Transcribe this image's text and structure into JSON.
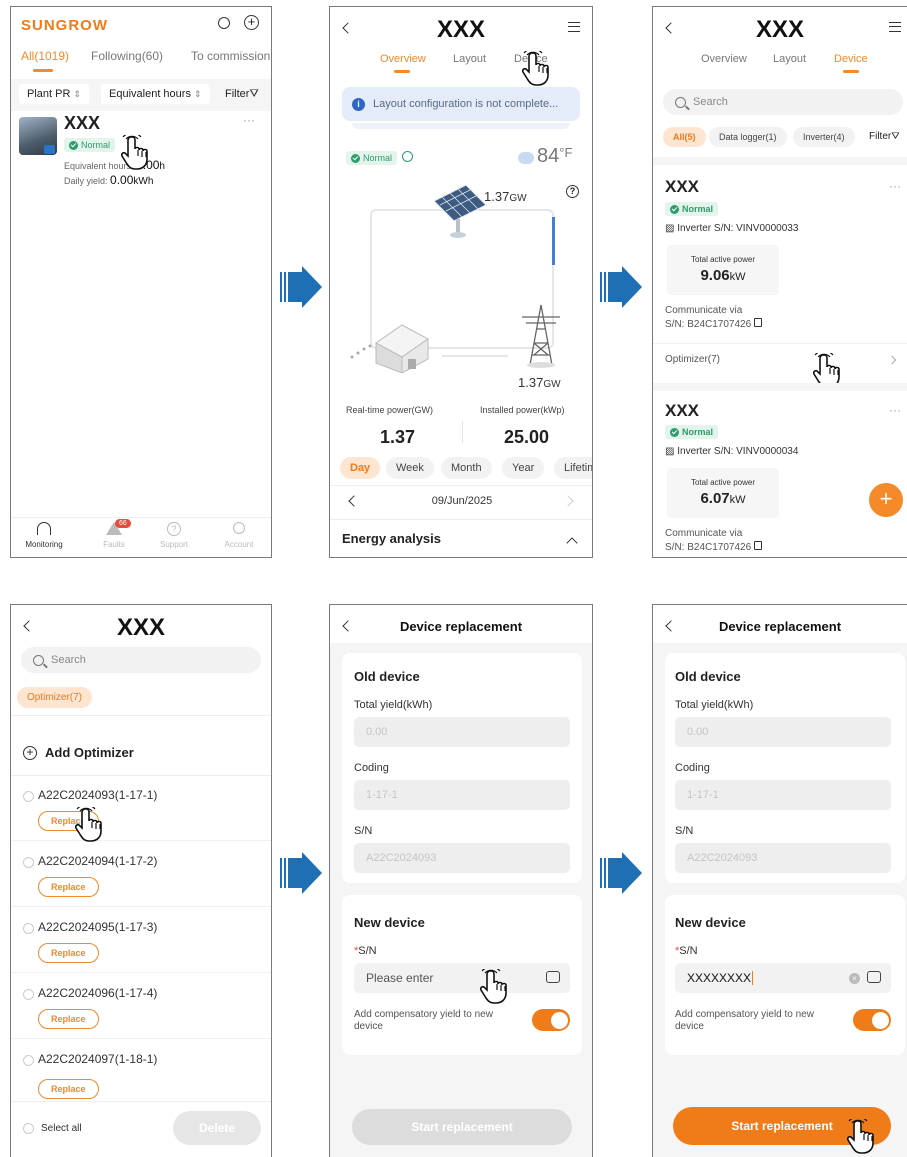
{
  "colors": {
    "accent": "#f08a2c",
    "normal": "#2f9c6b",
    "arrow": "#1f6fb5"
  },
  "p1": {
    "brand": "SUNGROW",
    "tabs": [
      "All(1019)",
      "Following(60)",
      "To commission"
    ],
    "filters": [
      "Plant PR",
      "Equivalent hours",
      "Filter"
    ],
    "plant": {
      "name": "XXX",
      "status": "Normal",
      "eq_label": "Equivalent hours:",
      "eq_value": "0.00",
      "eq_unit": "h",
      "dy_label": "Daily yield:",
      "dy_value": "0.00",
      "dy_unit": "kWh"
    },
    "bottom": [
      "Monitoring",
      "Faults",
      "Support",
      "Account"
    ],
    "faults_badge": "66"
  },
  "p2": {
    "title": "XXX",
    "tabs": [
      "Overview",
      "Layout",
      "Device"
    ],
    "banner": "Layout configuration is not complete...",
    "status": "Normal",
    "temp": "84",
    "temp_unit": "°F",
    "pv_value": "1.37",
    "pv_unit": "GW",
    "grid_value": "1.37",
    "grid_unit": "GW",
    "rt_label": "Real-time power(GW)",
    "rt_value": "1.37",
    "ip_label": "Installed power(kWp)",
    "ip_value": "25.00",
    "periods": [
      "Day",
      "Week",
      "Month",
      "Year",
      "Lifetime"
    ],
    "date": "09/Jun/2025",
    "energy": "Energy analysis"
  },
  "p3": {
    "title": "XXX",
    "tabs": [
      "Overview",
      "Layout",
      "Device"
    ],
    "search": "Search",
    "chips": [
      "All(5)",
      "Data logger(1)",
      "Inverter(4)"
    ],
    "filter": "Filter",
    "devices": [
      {
        "name": "XXX",
        "status": "Normal",
        "sn": "Inverter S/N: VINV0000033",
        "power_label": "Total active power",
        "power_value": "9.06",
        "power_unit": "kW",
        "comm1": "Communicate via",
        "comm2": "S/N: B24C1707426",
        "optimizer": "Optimizer(7)"
      },
      {
        "name": "XXX",
        "status": "Normal",
        "sn": "Inverter S/N: VINV0000034",
        "power_label": "Total active power",
        "power_value": "6.07",
        "power_unit": "kW",
        "comm1": "Communicate via",
        "comm2": "S/N: B24C1707426"
      }
    ]
  },
  "p4": {
    "title": "XXX",
    "search": "Search",
    "chip": "Optimizer(7)",
    "add": "Add Optimizer",
    "items": [
      "A22C2024093(1-17-1)",
      "A22C2024094(1-17-2)",
      "A22C2024095(1-17-3)",
      "A22C2024096(1-17-4)",
      "A22C2024097(1-18-1)"
    ],
    "replace": "Replace",
    "select_all": "Select all",
    "delete": "Delete"
  },
  "p5": {
    "title": "Device replacement",
    "old": "Old device",
    "yield_label": "Total yield(kWh)",
    "yield_val": "0.00",
    "coding_label": "Coding",
    "coding_val": "1-17-1",
    "sn_label": "S/N",
    "sn_val": "A22C2024093",
    "new": "New device",
    "new_sn_star": "*",
    "new_sn_label": "S/N",
    "new_sn_placeholder": "Please enter",
    "comp": "Add compensatory yield to new device",
    "start": "Start replacement"
  },
  "p6": {
    "title": "Device replacement",
    "old": "Old device",
    "yield_label": "Total yield(kWh)",
    "yield_val": "0.00",
    "coding_label": "Coding",
    "coding_val": "1-17-1",
    "sn_label": "S/N",
    "sn_val": "A22C2024093",
    "new": "New device",
    "new_sn_star": "*",
    "new_sn_label": "S/N",
    "new_sn_value": "XXXXXXXX",
    "comp": "Add compensatory yield to new device",
    "start": "Start replacement"
  }
}
